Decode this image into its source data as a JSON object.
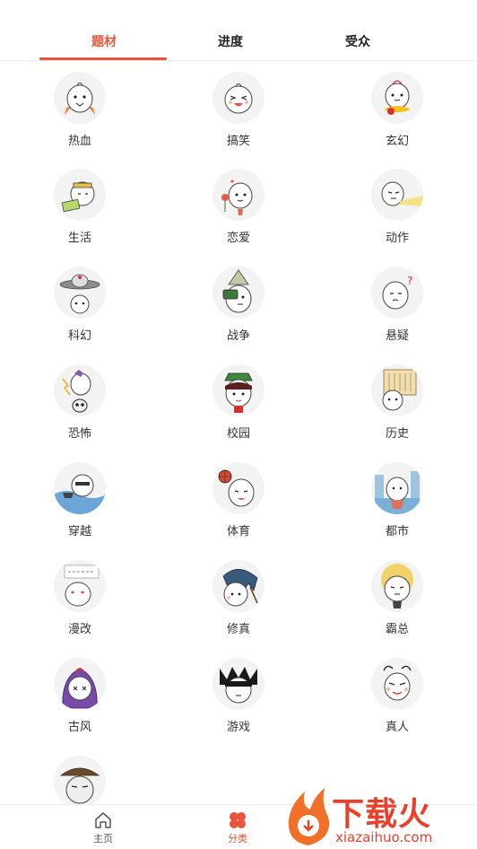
{
  "tabs": [
    {
      "label": "题材",
      "active": true
    },
    {
      "label": "进度",
      "active": false
    },
    {
      "label": "受众",
      "active": false
    }
  ],
  "categories": [
    {
      "label": "热血",
      "icon": "mascot-fire-icon"
    },
    {
      "label": "搞笑",
      "icon": "mascot-laugh-icon"
    },
    {
      "label": "玄幻",
      "icon": "mascot-fantasy-icon"
    },
    {
      "label": "生活",
      "icon": "mascot-life-icon"
    },
    {
      "label": "恋爱",
      "icon": "mascot-love-icon"
    },
    {
      "label": "动作",
      "icon": "mascot-action-icon"
    },
    {
      "label": "科幻",
      "icon": "mascot-scifi-ufo-icon"
    },
    {
      "label": "战争",
      "icon": "mascot-war-icon"
    },
    {
      "label": "悬疑",
      "icon": "mascot-mystery-icon"
    },
    {
      "label": "恐怖",
      "icon": "mascot-horror-skull-icon"
    },
    {
      "label": "校园",
      "icon": "mascot-campus-icon"
    },
    {
      "label": "历史",
      "icon": "mascot-history-icon"
    },
    {
      "label": "穿越",
      "icon": "mascot-timetravel-icon"
    },
    {
      "label": "体育",
      "icon": "mascot-sports-ball-icon"
    },
    {
      "label": "都市",
      "icon": "mascot-city-icon"
    },
    {
      "label": "漫改",
      "icon": "mascot-adaptation-icon"
    },
    {
      "label": "修真",
      "icon": "mascot-cultivation-icon"
    },
    {
      "label": "霸总",
      "icon": "mascot-ceo-icon"
    },
    {
      "label": "古风",
      "icon": "mascot-ancient-icon"
    },
    {
      "label": "游戏",
      "icon": "mascot-game-icon"
    },
    {
      "label": "真人",
      "icon": "mascot-reallife-icon"
    },
    {
      "label": "",
      "icon": "mascot-hat-icon"
    }
  ],
  "bottom_nav": [
    {
      "label": "主页",
      "icon": "home-icon",
      "active": false
    },
    {
      "label": "分类",
      "icon": "category-clover-icon",
      "active": true
    }
  ],
  "watermark": {
    "text": "下载火",
    "url": "xiazaihuo.com"
  },
  "colors": {
    "accent": "#e8553a",
    "text": "#333333",
    "divider": "#ececec",
    "avatar_bg": "#f3f3f3"
  }
}
